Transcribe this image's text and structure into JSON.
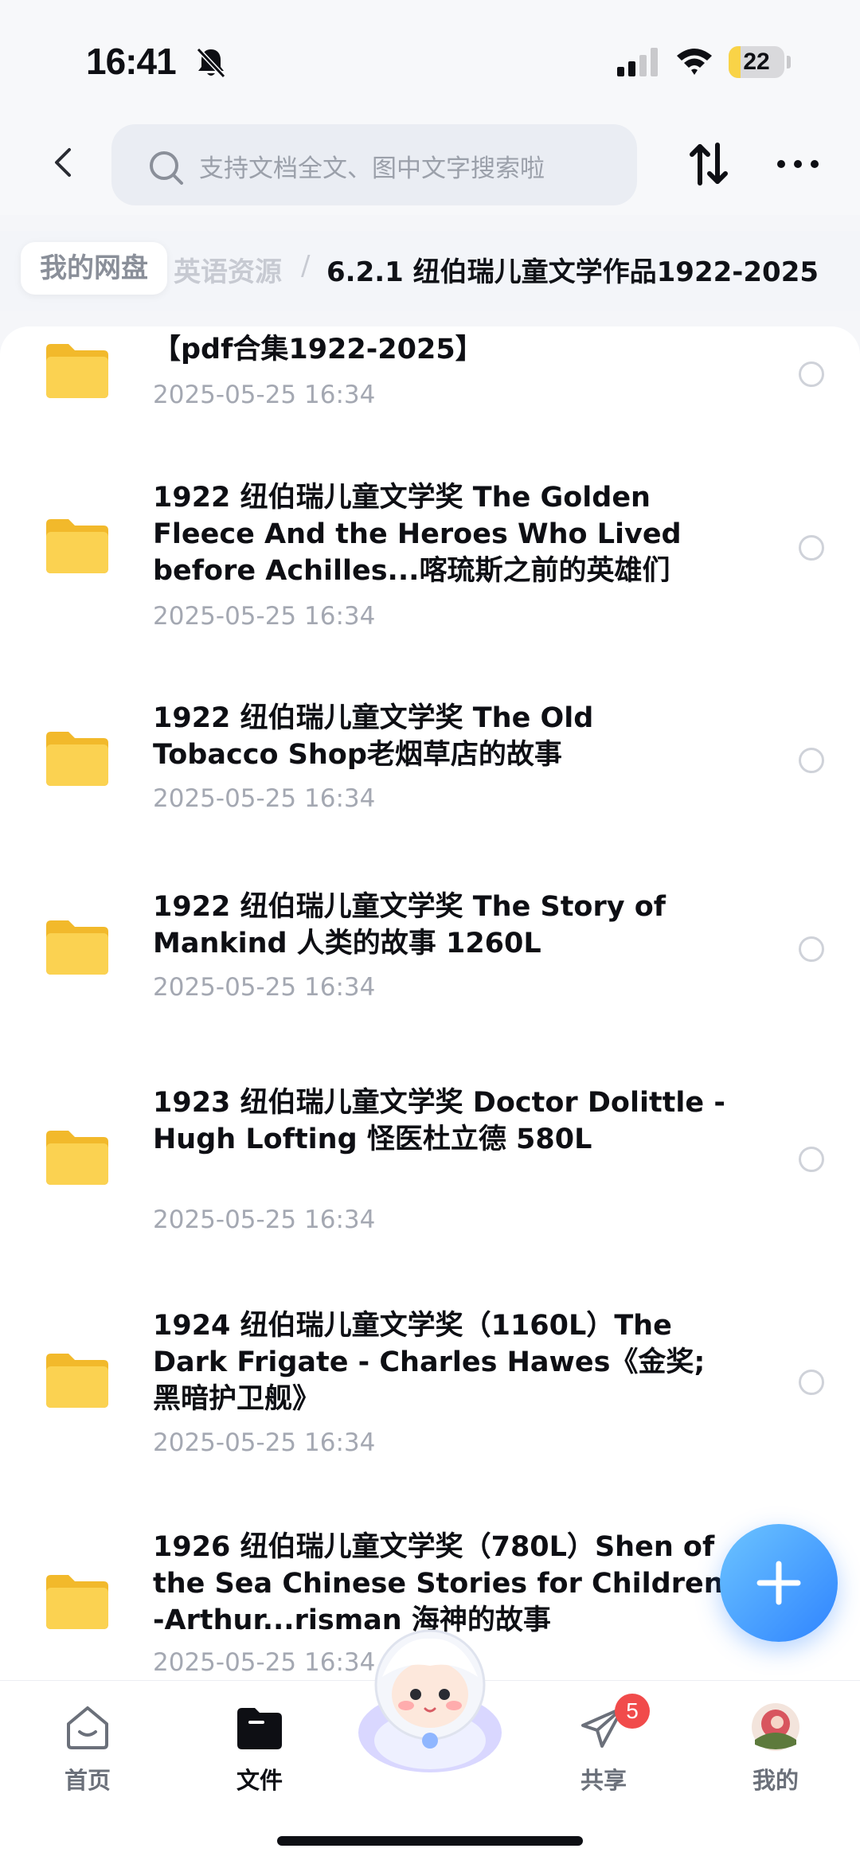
{
  "status_bar": {
    "time": "16:41",
    "battery_level": "22",
    "battery_fraction": 0.22
  },
  "header": {
    "search_placeholder": "支持文档全文、图中文字搜索啦",
    "icons": [
      "chevron-left-icon",
      "search-icon",
      "sort-icon",
      "more-icon"
    ]
  },
  "breadcrumb": {
    "root": "我的网盘",
    "middle": "英语资源",
    "separator": "/",
    "current": "6.2.1 纽伯瑞儿童文学作品1922-2025"
  },
  "files": [
    {
      "title": "【pdf合集1922-2025】",
      "date": "2025-05-25 16:34"
    },
    {
      "title": "1922 纽伯瑞儿童文学奖 The Golden Fleece  And the Heroes Who Lived before Achilles...喀琉斯之前的英雄们",
      "date": "2025-05-25 16:34"
    },
    {
      "title": "1922 纽伯瑞儿童文学奖 The Old Tobacco Shop老烟草店的故事",
      "date": "2025-05-25 16:34"
    },
    {
      "title": "1922 纽伯瑞儿童文学奖 The Story of Mankind 人类的故事 1260L",
      "date": "2025-05-25 16:34"
    },
    {
      "title": "1923 纽伯瑞儿童文学奖 Doctor Dolittle - Hugh Lofting 怪医杜立德 580L",
      "date": "2025-05-25 16:34"
    },
    {
      "title": "1924 纽伯瑞儿童文学奖（1160L）The Dark Frigate - Charles Hawes《金奖;黑暗护卫舰》",
      "date": "2025-05-25 16:34"
    },
    {
      "title": "1926 纽伯瑞儿童文学奖（780L）Shen of the Sea  Chinese Stories for Children -Arthur...risman 海神的故事",
      "date": "2025-05-25 16:34"
    }
  ],
  "tabbar": {
    "tabs": [
      {
        "label": "首页",
        "icon": "home-icon"
      },
      {
        "label": "文件",
        "icon": "folder-icon"
      },
      {
        "label": "",
        "icon": "mascot-icon"
      },
      {
        "label": "共享",
        "icon": "send-icon",
        "badge": "5"
      },
      {
        "label": "我的",
        "icon": "avatar"
      }
    ]
  },
  "fab": {
    "icon": "plus-icon"
  },
  "colors": {
    "accent": "#2f84ff",
    "folder": "#f9c93d",
    "badge": "#f14b4b"
  }
}
